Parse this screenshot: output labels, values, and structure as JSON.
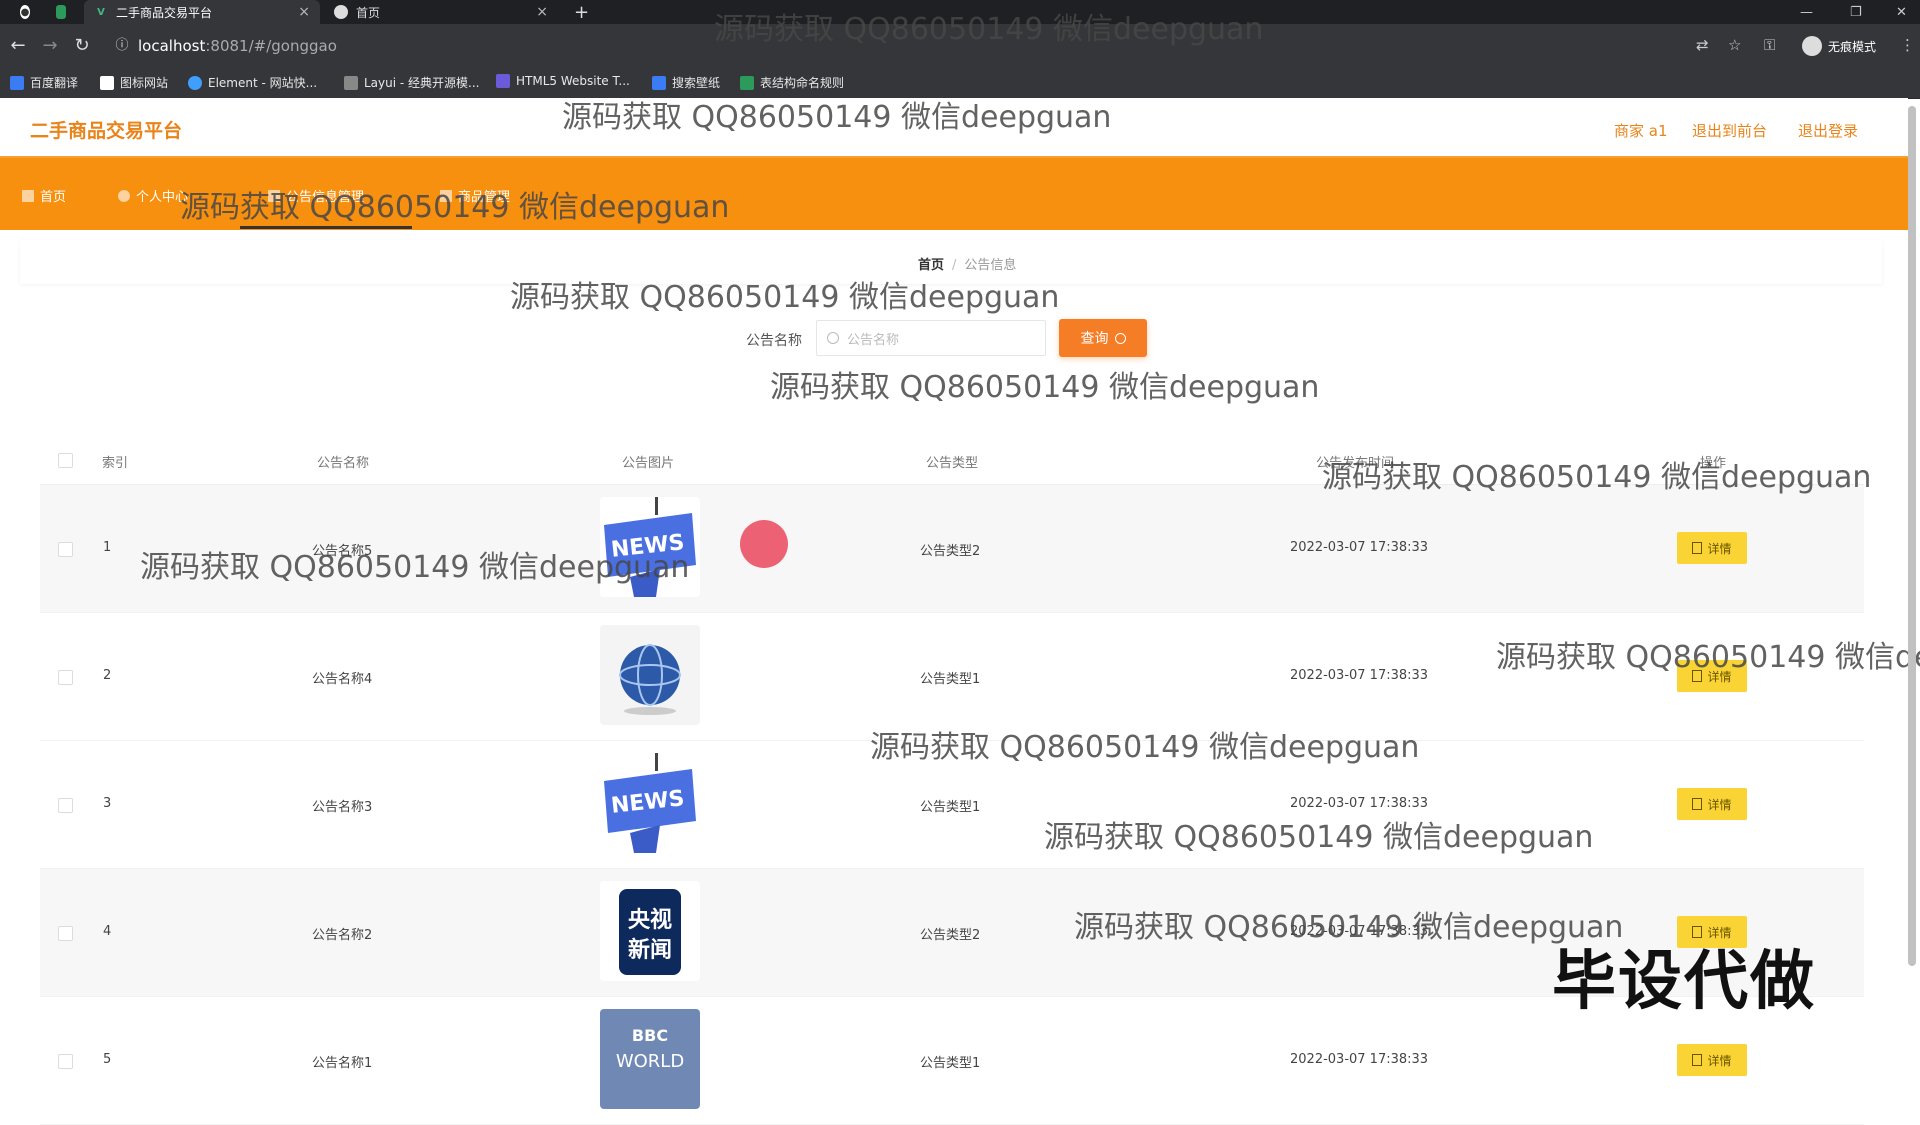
{
  "browser": {
    "tabs": [
      {
        "title": "二手商品交易平台",
        "active": true
      },
      {
        "title": "首页",
        "active": false
      }
    ],
    "url_host": "localhost",
    "url_rest": ":8081/#/gonggao",
    "incognito_label": "无痕模式",
    "bookmarks": [
      "百度翻译",
      "图标网站",
      "Element - 网站快...",
      "Layui - 经典开源模...",
      "HTML5 Website T...",
      "搜索壁纸",
      "表结构命名规则"
    ]
  },
  "header": {
    "brand": "二手商品交易平台",
    "user": "商家 a1",
    "back_front": "退出到前台",
    "logout": "退出登录"
  },
  "nav": [
    "首页",
    "个人中心",
    "公告信息管理",
    "商品管理"
  ],
  "breadcrumb": {
    "home": "首页",
    "current": "公告信息"
  },
  "search": {
    "label": "公告名称",
    "placeholder": "公告名称",
    "button": "查询"
  },
  "table": {
    "headers": [
      "索引",
      "公告名称",
      "公告图片",
      "公告类型",
      "公告发布时间",
      "操作"
    ],
    "detail_label": "详情",
    "rows": [
      {
        "index": "1",
        "name": "公告名称5",
        "type": "公告类型2",
        "time": "2022-03-07 17:38:33",
        "image": "news-blue"
      },
      {
        "index": "2",
        "name": "公告名称4",
        "type": "公告类型1",
        "time": "2022-03-07 17:38:33",
        "image": "news-globe"
      },
      {
        "index": "3",
        "name": "公告名称3",
        "type": "公告类型1",
        "time": "2022-03-07 17:38:33",
        "image": "news-blue"
      },
      {
        "index": "4",
        "name": "公告名称2",
        "type": "公告类型2",
        "time": "2022-03-07 17:38:33",
        "image": "cctv-news"
      },
      {
        "index": "5",
        "name": "公告名称1",
        "type": "公告类型1",
        "time": "2022-03-07 17:38:33",
        "image": "bbc-world"
      }
    ]
  },
  "images": {
    "news_text": "NEWS",
    "cctv_line1": "央视",
    "cctv_line2": "新闻",
    "bbc_line1": "BBC",
    "bbc_line2": "WORLD"
  },
  "watermark": "源码获取 QQ86050149 微信deepguan",
  "big_watermark": "毕设代做",
  "colors": {
    "accent": "#f78f0f",
    "brand": "#e8841a",
    "detail": "#f9d434"
  }
}
